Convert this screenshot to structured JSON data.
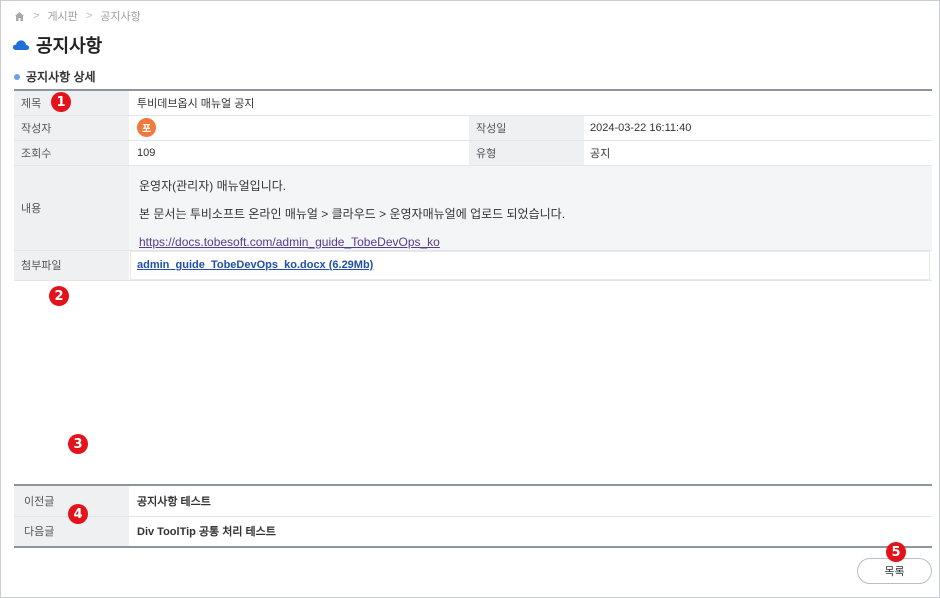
{
  "breadcrumb": {
    "items": [
      "게시판",
      "공지사항"
    ]
  },
  "page": {
    "title": "공지사항"
  },
  "section": {
    "title": "공지사항 상세"
  },
  "detail": {
    "title_label": "제목",
    "title_value": "투비데브옵시 매뉴얼 공지",
    "author_label": "작성자",
    "author_avatar": "포",
    "date_label": "작성일",
    "date_value": "2024-03-22 16:11:40",
    "views_label": "조회수",
    "views_value": "109",
    "type_label": "유형",
    "type_value": "공지",
    "content_label": "내용",
    "content_lines": [
      "운영자(관리자) 매뉴얼입니다.",
      "본 문서는 투비소프트 온라인 매뉴얼 > 클라우드 > 운영자매뉴얼에 업로드 되었습니다."
    ],
    "content_link": "https://docs.tobesoft.com/admin_guide_TobeDevOps_ko",
    "attachment_label": "첨부파일",
    "attachment_file": "admin_guide_TobeDevOps_ko.docx (6.29Mb)"
  },
  "navigation": {
    "prev_label": "이전글",
    "prev_value": "공지사항 테스트",
    "next_label": "다음글",
    "next_value": "Div ToolTip 공통 처리 테스트"
  },
  "buttons": {
    "list_label": "목록"
  },
  "markers": [
    "1",
    "2",
    "3",
    "4",
    "5"
  ],
  "colors": {
    "marker": "#e3131b",
    "avatar": "#f07a3c",
    "accent_dot": "#6aa2e8",
    "link": "#1f4fa8"
  }
}
